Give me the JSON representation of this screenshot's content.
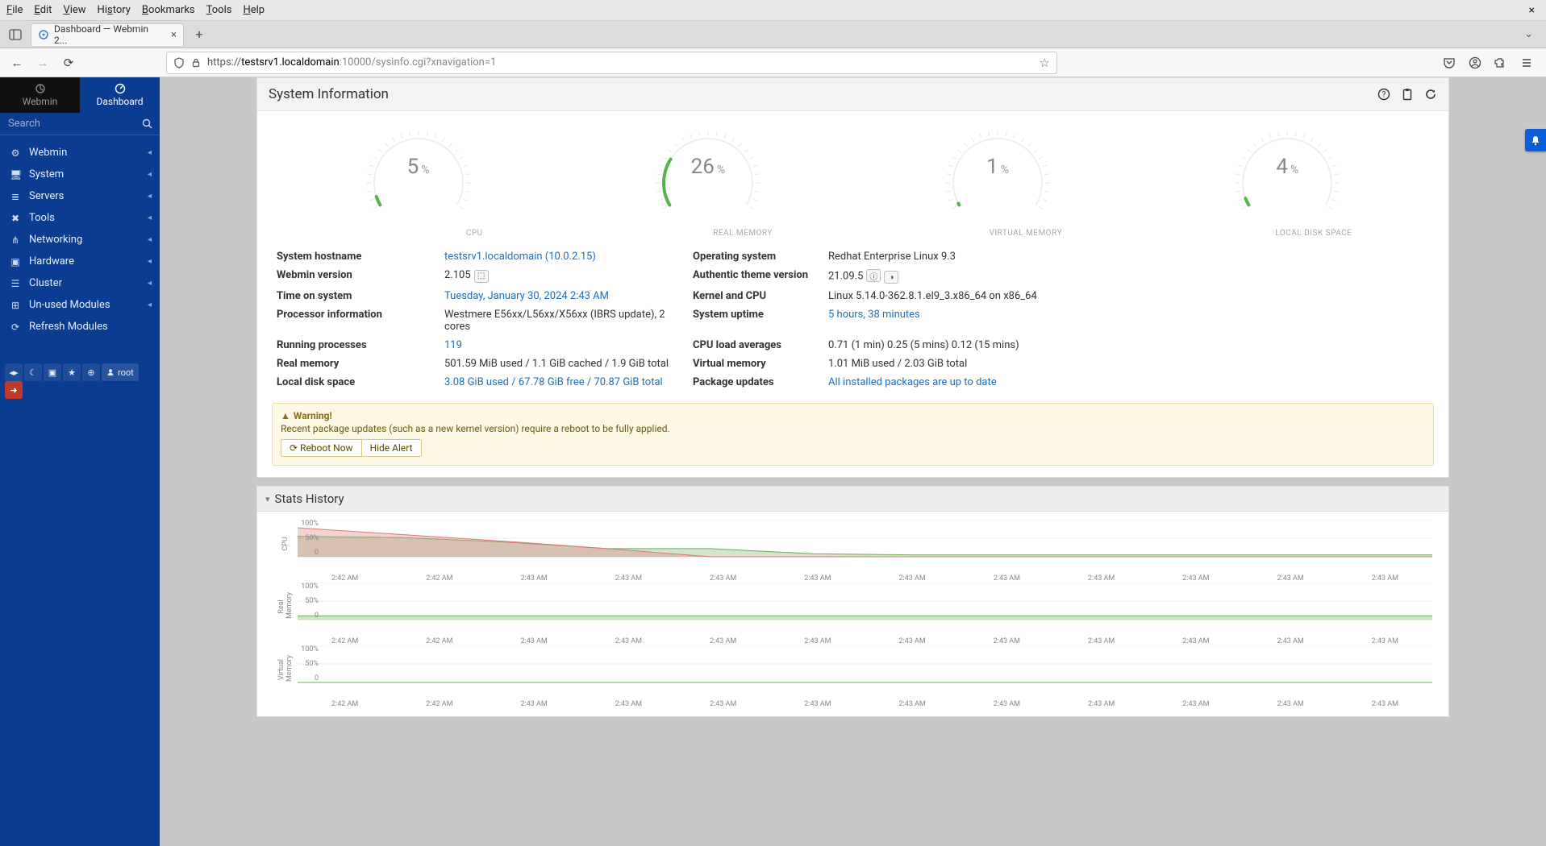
{
  "browser": {
    "menus": [
      "File",
      "Edit",
      "View",
      "History",
      "Bookmarks",
      "Tools",
      "Help"
    ],
    "tab_title": "Dashboard — Webmin 2...",
    "url_proto": "https://",
    "url_host": "testsrv1.localdomain",
    "url_rest": ":10000/sysinfo.cgi?xnavigation=1"
  },
  "sidebar": {
    "tabs": {
      "webmin": "Webmin",
      "dashboard": "Dashboard"
    },
    "search_placeholder": "Search",
    "items": [
      {
        "icon": "⚙",
        "label": "Webmin"
      },
      {
        "icon": "🖥",
        "label": "System"
      },
      {
        "icon": "≣",
        "label": "Servers"
      },
      {
        "icon": "✖",
        "label": "Tools"
      },
      {
        "icon": "⋔",
        "label": "Networking"
      },
      {
        "icon": "▣",
        "label": "Hardware"
      },
      {
        "icon": "☰",
        "label": "Cluster"
      },
      {
        "icon": "⊞",
        "label": "Un-used Modules"
      },
      {
        "icon": "⟳",
        "label": "Refresh Modules"
      }
    ],
    "user": "root"
  },
  "header": {
    "title": "System Information"
  },
  "gauges": [
    {
      "value": 5,
      "label": "CPU"
    },
    {
      "value": 26,
      "label": "REAL MEMORY"
    },
    {
      "value": 1,
      "label": "VIRTUAL MEMORY"
    },
    {
      "value": 4,
      "label": "LOCAL DISK SPACE"
    }
  ],
  "info": {
    "left": [
      {
        "label": "System hostname",
        "value": "testsrv1.localdomain (10.0.2.15)",
        "link": true
      },
      {
        "label": "Webmin version",
        "value": "2.105",
        "badge": "⬚"
      },
      {
        "label": "Time on system",
        "value": "Tuesday, January 30, 2024 2:43 AM",
        "link": true
      },
      {
        "label": "Processor information",
        "value": "Westmere E56xx/L56xx/X56xx (IBRS update), 2 cores"
      },
      {
        "label": "Running processes",
        "value": "119",
        "link": true
      },
      {
        "label": "Real memory",
        "value": "501.59 MiB used / 1.1 GiB cached / 1.9 GiB total"
      },
      {
        "label": "Local disk space",
        "value": "3.08 GiB used / 67.78 GiB free / 70.87 GiB total",
        "link": true
      }
    ],
    "right": [
      {
        "label": "Operating system",
        "value": "Redhat Enterprise Linux 9.3"
      },
      {
        "label": "Authentic theme version",
        "value": "21.09.5",
        "badge2": true
      },
      {
        "label": "Kernel and CPU",
        "value": "Linux 5.14.0-362.8.1.el9_3.x86_64 on x86_64"
      },
      {
        "label": "System uptime",
        "value": "5 hours, 38 minutes",
        "link": true
      },
      {
        "label": "CPU load averages",
        "value": "0.71 (1 min) 0.25 (5 mins) 0.12 (15 mins)"
      },
      {
        "label": "Virtual memory",
        "value": "1.01 MiB used / 2.03 GiB total"
      },
      {
        "label": "Package updates",
        "value": "All installed packages are up to date",
        "link": true
      }
    ]
  },
  "alert": {
    "title": "Warning!",
    "text": "Recent package updates (such as a new kernel version) require a reboot to be fully applied.",
    "reboot_btn": "Reboot Now",
    "hide_btn": "Hide Alert"
  },
  "stats": {
    "title": "Stats History",
    "ylabels": [
      "100%",
      "50%",
      "0"
    ],
    "xlabels": [
      "2:42 AM",
      "2:42 AM",
      "2:43 AM",
      "2:43 AM",
      "2:43 AM",
      "2:43 AM",
      "2:43 AM",
      "2:43 AM",
      "2:43 AM",
      "2:43 AM",
      "2:43 AM",
      "2:43 AM"
    ],
    "rows": [
      {
        "name": "CPU"
      },
      {
        "name": "Real Memory"
      },
      {
        "name": "Virtual Memory"
      }
    ]
  },
  "chart_data": [
    {
      "type": "area",
      "title": "CPU",
      "ylabel": "%",
      "ylim": [
        0,
        100
      ],
      "x": [
        "2:42 AM",
        "2:42 AM",
        "2:43 AM",
        "2:43 AM",
        "2:43 AM",
        "2:43 AM",
        "2:43 AM",
        "2:43 AM",
        "2:43 AM",
        "2:43 AM",
        "2:43 AM",
        "2:43 AM"
      ],
      "series": [
        {
          "name": "cpu-green",
          "values": [
            55,
            52,
            40,
            22,
            22,
            8,
            5,
            5,
            5,
            5,
            5,
            5
          ]
        },
        {
          "name": "cpu-red",
          "values": [
            78,
            60,
            42,
            22,
            0,
            0,
            0,
            0,
            0,
            0,
            0,
            0
          ]
        }
      ]
    },
    {
      "type": "area",
      "title": "Real Memory",
      "ylabel": "%",
      "ylim": [
        0,
        100
      ],
      "x": [
        "2:42 AM",
        "2:42 AM",
        "2:43 AM",
        "2:43 AM",
        "2:43 AM",
        "2:43 AM",
        "2:43 AM",
        "2:43 AM",
        "2:43 AM",
        "2:43 AM",
        "2:43 AM",
        "2:43 AM"
      ],
      "series": [
        {
          "name": "real-mem",
          "values": [
            10,
            10,
            10,
            10,
            10,
            10,
            10,
            10,
            10,
            10,
            10,
            10
          ]
        }
      ]
    },
    {
      "type": "area",
      "title": "Virtual Memory",
      "ylabel": "%",
      "ylim": [
        0,
        100
      ],
      "x": [
        "2:42 AM",
        "2:42 AM",
        "2:43 AM",
        "2:43 AM",
        "2:43 AM",
        "2:43 AM",
        "2:43 AM",
        "2:43 AM",
        "2:43 AM",
        "2:43 AM",
        "2:43 AM",
        "2:43 AM"
      ],
      "series": [
        {
          "name": "virt-mem",
          "values": [
            0,
            0,
            0,
            0,
            0,
            0,
            0,
            0,
            0,
            0,
            0,
            0
          ]
        }
      ]
    }
  ]
}
